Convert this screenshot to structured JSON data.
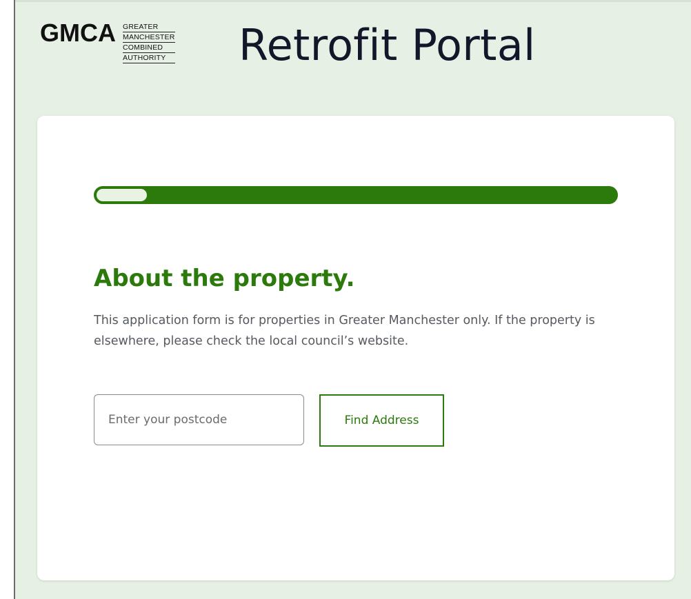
{
  "header": {
    "logo_mark": "GMCA",
    "logo_words": [
      "GREATER",
      "MANCHESTER",
      "COMBINED",
      "AUTHORITY"
    ],
    "title": "Retrofit Portal"
  },
  "form": {
    "progress_fraction": 0.1,
    "heading": "About the property.",
    "description": "This application form is for properties in Greater Manchester only. If the property is elsewhere, please check the local council’s website.",
    "postcode_placeholder": "Enter your postcode",
    "postcode_value": "",
    "find_button_label": "Find Address"
  },
  "colors": {
    "accent": "#2b7a0b",
    "background": "#e6f0e4",
    "card": "#ffffff"
  }
}
